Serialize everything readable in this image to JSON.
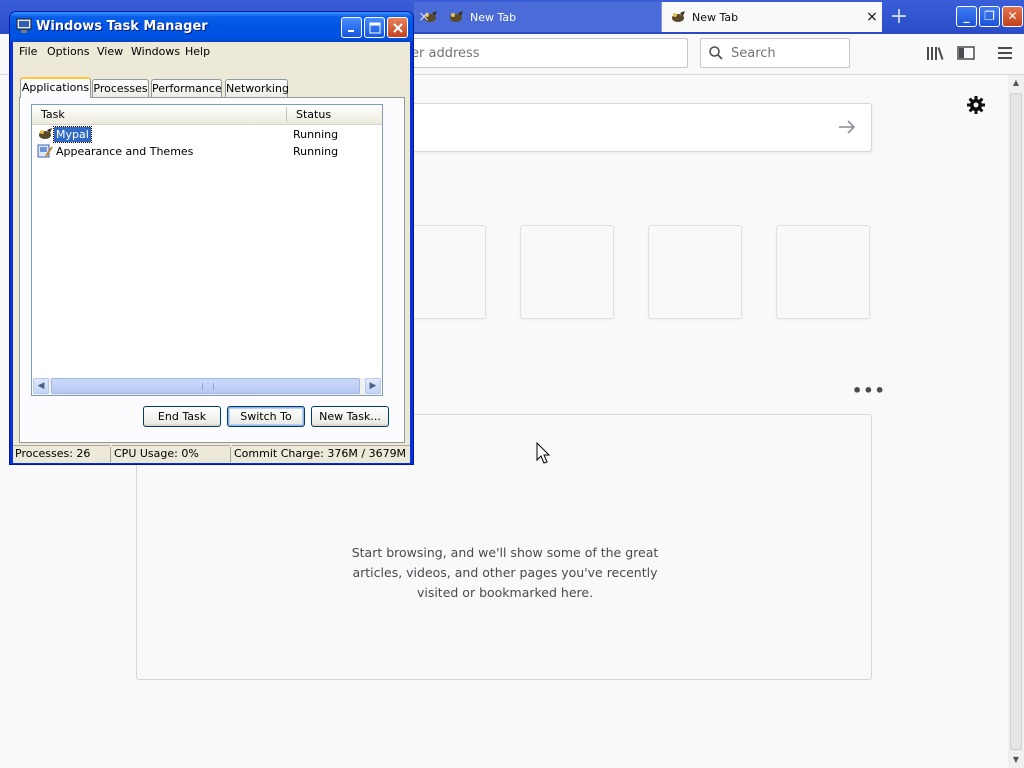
{
  "browser": {
    "tabs": [
      {
        "label": "New Tab",
        "state": "inactive"
      },
      {
        "label": "New Tab",
        "state": "active"
      }
    ],
    "address_placeholder": "er address",
    "search_placeholder": "Search",
    "highlights_message": "Start browsing, and we'll show some of the great articles, videos, and other pages you've recently visited or bookmarked here.",
    "more_label": "•••"
  },
  "taskmgr": {
    "title": "Windows Task Manager",
    "menu": [
      "File",
      "Options",
      "View",
      "Windows",
      "Help"
    ],
    "tabs": [
      "Applications",
      "Processes",
      "Performance",
      "Networking"
    ],
    "active_tab": "Applications",
    "columns": {
      "task": "Task",
      "status": "Status"
    },
    "rows": [
      {
        "name": "Mypal",
        "status": "Running",
        "selected": true
      },
      {
        "name": "Appearance and Themes",
        "status": "Running",
        "selected": false
      }
    ],
    "buttons": {
      "end_task": "End Task",
      "switch_to": "Switch To",
      "new_task": "New Task..."
    },
    "status": {
      "processes": "Processes: 26",
      "cpu": "CPU Usage: 0%",
      "commit": "Commit Charge: 376M / 3679M"
    }
  },
  "colors": {
    "xp_title_blue": "#0054e3",
    "xp_face": "#ece9d8",
    "selection": "#316ac5",
    "tab_accent": "#ffc83c"
  },
  "icons": [
    "gear-icon",
    "arrow-right-icon",
    "search-icon",
    "library-icon",
    "sidebar-icon",
    "hamburger-menu-icon",
    "task-manager-icon",
    "mypal-icon",
    "appearance-themes-icon",
    "mouse-cursor-icon"
  ]
}
